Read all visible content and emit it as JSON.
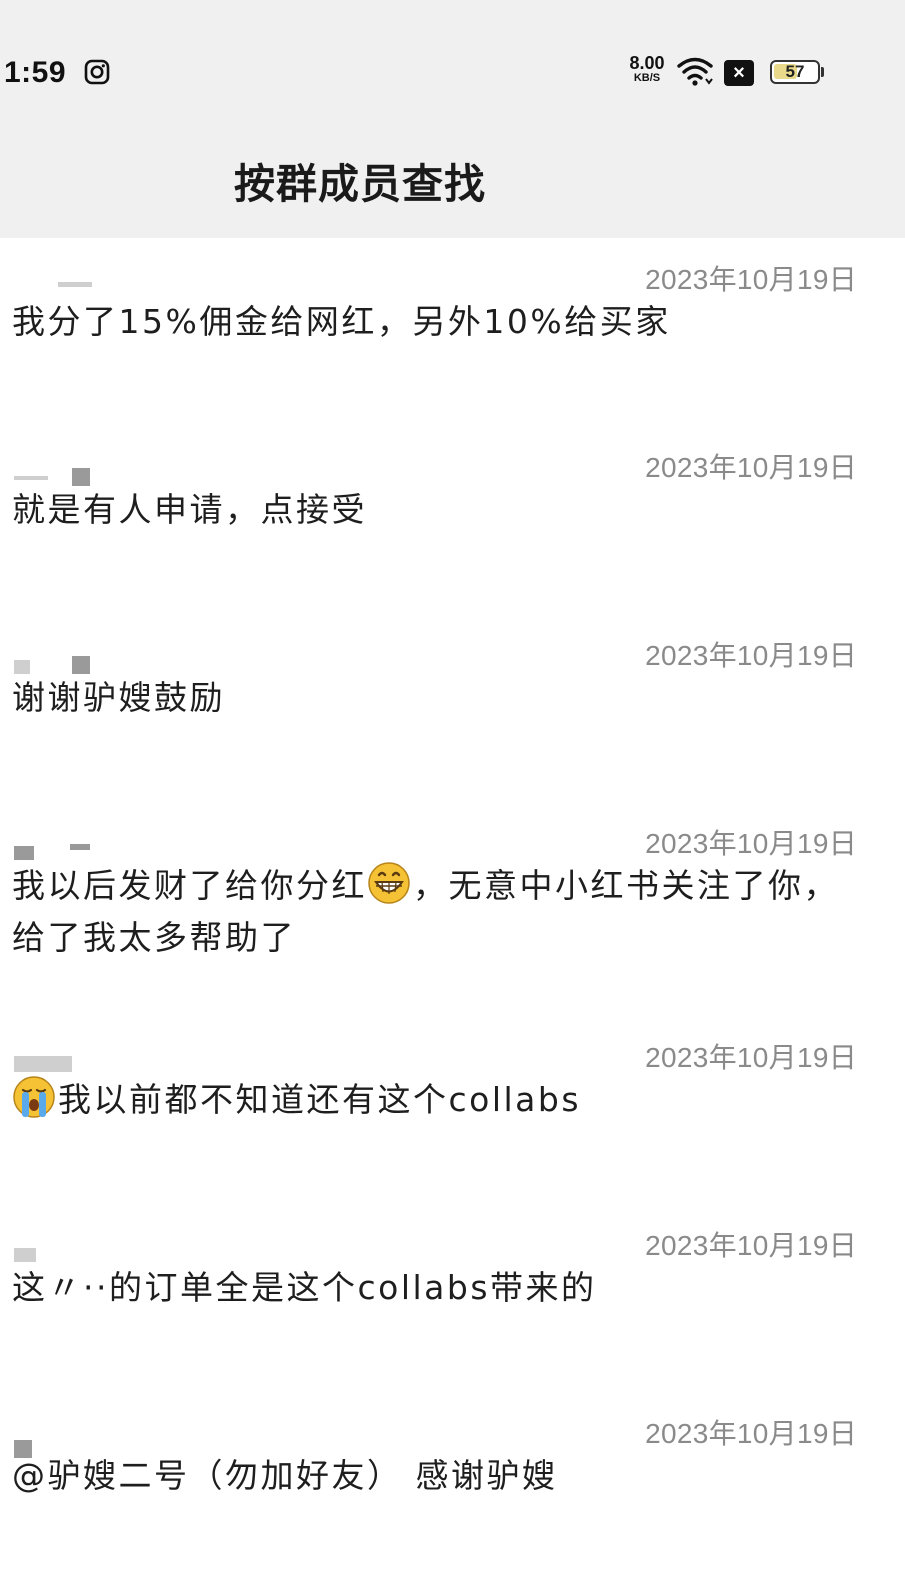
{
  "status_bar": {
    "time": "1:59",
    "net_speed_value": "8.00",
    "net_speed_unit": "KB/S",
    "battery_level": "57",
    "battery_fraction": 0.57,
    "close_badge": "×"
  },
  "header": {
    "title": "按群成员查找"
  },
  "messages": [
    {
      "date": "2023年10月19日",
      "text": "我分了15%佣金给网红，另外10%给买家"
    },
    {
      "date": "2023年10月19日",
      "text": "就是有人申请，点接受"
    },
    {
      "date": "2023年10月19日",
      "text": "谢谢驴嫂鼓励"
    },
    {
      "date": "2023年10月19日",
      "text_before_emoji": "我以后发财了给你分红",
      "emoji": "grinning-face-emoji",
      "text_after_emoji": "，无意中小红书关注了你，给了我太多帮助了"
    },
    {
      "date": "2023年10月19日",
      "emoji": "crying-face-emoji",
      "text_after_emoji": "我以前都不知道还有这个collabs"
    },
    {
      "date": "2023年10月19日",
      "text": "这〃··的订单全是这个collabs带来的"
    },
    {
      "date": "2023年10月19日",
      "text": "@驴嫂二号（勿加好友） 感谢驴嫂"
    }
  ],
  "colors": {
    "header_bg": "#f0f0f0",
    "date_text": "#8a8a8a",
    "message_text": "#1e1e1e",
    "battery_fill": "#e9d98a"
  }
}
